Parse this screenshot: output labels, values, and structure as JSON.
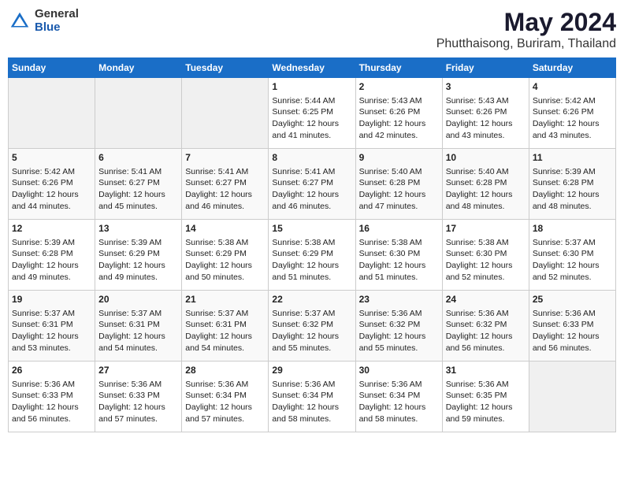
{
  "header": {
    "logo_general": "General",
    "logo_blue": "Blue",
    "title": "May 2024",
    "subtitle": "Phutthaisong, Buriram, Thailand"
  },
  "days_of_week": [
    "Sunday",
    "Monday",
    "Tuesday",
    "Wednesday",
    "Thursday",
    "Friday",
    "Saturday"
  ],
  "weeks": [
    [
      {
        "day": "",
        "info": ""
      },
      {
        "day": "",
        "info": ""
      },
      {
        "day": "",
        "info": ""
      },
      {
        "day": "1",
        "info": "Sunrise: 5:44 AM\nSunset: 6:25 PM\nDaylight: 12 hours\nand 41 minutes."
      },
      {
        "day": "2",
        "info": "Sunrise: 5:43 AM\nSunset: 6:26 PM\nDaylight: 12 hours\nand 42 minutes."
      },
      {
        "day": "3",
        "info": "Sunrise: 5:43 AM\nSunset: 6:26 PM\nDaylight: 12 hours\nand 43 minutes."
      },
      {
        "day": "4",
        "info": "Sunrise: 5:42 AM\nSunset: 6:26 PM\nDaylight: 12 hours\nand 43 minutes."
      }
    ],
    [
      {
        "day": "5",
        "info": "Sunrise: 5:42 AM\nSunset: 6:26 PM\nDaylight: 12 hours\nand 44 minutes."
      },
      {
        "day": "6",
        "info": "Sunrise: 5:41 AM\nSunset: 6:27 PM\nDaylight: 12 hours\nand 45 minutes."
      },
      {
        "day": "7",
        "info": "Sunrise: 5:41 AM\nSunset: 6:27 PM\nDaylight: 12 hours\nand 46 minutes."
      },
      {
        "day": "8",
        "info": "Sunrise: 5:41 AM\nSunset: 6:27 PM\nDaylight: 12 hours\nand 46 minutes."
      },
      {
        "day": "9",
        "info": "Sunrise: 5:40 AM\nSunset: 6:28 PM\nDaylight: 12 hours\nand 47 minutes."
      },
      {
        "day": "10",
        "info": "Sunrise: 5:40 AM\nSunset: 6:28 PM\nDaylight: 12 hours\nand 48 minutes."
      },
      {
        "day": "11",
        "info": "Sunrise: 5:39 AM\nSunset: 6:28 PM\nDaylight: 12 hours\nand 48 minutes."
      }
    ],
    [
      {
        "day": "12",
        "info": "Sunrise: 5:39 AM\nSunset: 6:28 PM\nDaylight: 12 hours\nand 49 minutes."
      },
      {
        "day": "13",
        "info": "Sunrise: 5:39 AM\nSunset: 6:29 PM\nDaylight: 12 hours\nand 49 minutes."
      },
      {
        "day": "14",
        "info": "Sunrise: 5:38 AM\nSunset: 6:29 PM\nDaylight: 12 hours\nand 50 minutes."
      },
      {
        "day": "15",
        "info": "Sunrise: 5:38 AM\nSunset: 6:29 PM\nDaylight: 12 hours\nand 51 minutes."
      },
      {
        "day": "16",
        "info": "Sunrise: 5:38 AM\nSunset: 6:30 PM\nDaylight: 12 hours\nand 51 minutes."
      },
      {
        "day": "17",
        "info": "Sunrise: 5:38 AM\nSunset: 6:30 PM\nDaylight: 12 hours\nand 52 minutes."
      },
      {
        "day": "18",
        "info": "Sunrise: 5:37 AM\nSunset: 6:30 PM\nDaylight: 12 hours\nand 52 minutes."
      }
    ],
    [
      {
        "day": "19",
        "info": "Sunrise: 5:37 AM\nSunset: 6:31 PM\nDaylight: 12 hours\nand 53 minutes."
      },
      {
        "day": "20",
        "info": "Sunrise: 5:37 AM\nSunset: 6:31 PM\nDaylight: 12 hours\nand 54 minutes."
      },
      {
        "day": "21",
        "info": "Sunrise: 5:37 AM\nSunset: 6:31 PM\nDaylight: 12 hours\nand 54 minutes."
      },
      {
        "day": "22",
        "info": "Sunrise: 5:37 AM\nSunset: 6:32 PM\nDaylight: 12 hours\nand 55 minutes."
      },
      {
        "day": "23",
        "info": "Sunrise: 5:36 AM\nSunset: 6:32 PM\nDaylight: 12 hours\nand 55 minutes."
      },
      {
        "day": "24",
        "info": "Sunrise: 5:36 AM\nSunset: 6:32 PM\nDaylight: 12 hours\nand 56 minutes."
      },
      {
        "day": "25",
        "info": "Sunrise: 5:36 AM\nSunset: 6:33 PM\nDaylight: 12 hours\nand 56 minutes."
      }
    ],
    [
      {
        "day": "26",
        "info": "Sunrise: 5:36 AM\nSunset: 6:33 PM\nDaylight: 12 hours\nand 56 minutes."
      },
      {
        "day": "27",
        "info": "Sunrise: 5:36 AM\nSunset: 6:33 PM\nDaylight: 12 hours\nand 57 minutes."
      },
      {
        "day": "28",
        "info": "Sunrise: 5:36 AM\nSunset: 6:34 PM\nDaylight: 12 hours\nand 57 minutes."
      },
      {
        "day": "29",
        "info": "Sunrise: 5:36 AM\nSunset: 6:34 PM\nDaylight: 12 hours\nand 58 minutes."
      },
      {
        "day": "30",
        "info": "Sunrise: 5:36 AM\nSunset: 6:34 PM\nDaylight: 12 hours\nand 58 minutes."
      },
      {
        "day": "31",
        "info": "Sunrise: 5:36 AM\nSunset: 6:35 PM\nDaylight: 12 hours\nand 59 minutes."
      },
      {
        "day": "",
        "info": ""
      }
    ]
  ]
}
